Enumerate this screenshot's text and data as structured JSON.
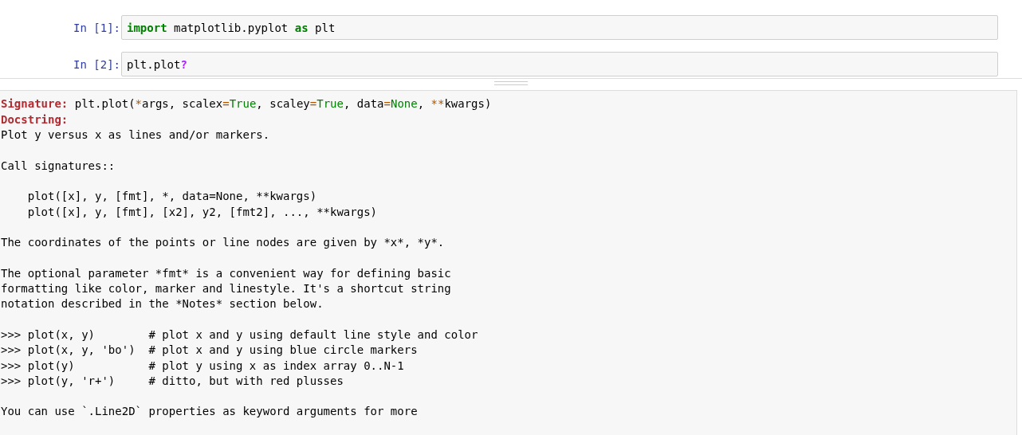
{
  "cells": [
    {
      "prompt": "In [1]:",
      "tokens": [
        {
          "text": "import",
          "kind": "keyword"
        },
        {
          "text": " matplotlib.pyplot ",
          "kind": "plain"
        },
        {
          "text": "as",
          "kind": "keyword"
        },
        {
          "text": " plt",
          "kind": "plain"
        }
      ]
    },
    {
      "prompt": "In [2]:",
      "tokens": [
        {
          "text": "plt.plot",
          "kind": "plain"
        },
        {
          "text": "?",
          "kind": "help"
        }
      ]
    }
  ],
  "pager": {
    "signature": [
      {
        "text": "Signature:",
        "kind": "label"
      },
      {
        "text": " plt.plot(",
        "kind": "plain"
      },
      {
        "text": "*",
        "kind": "op"
      },
      {
        "text": "args, scalex",
        "kind": "plain"
      },
      {
        "text": "=",
        "kind": "op"
      },
      {
        "text": "True",
        "kind": "constant"
      },
      {
        "text": ", scaley",
        "kind": "plain"
      },
      {
        "text": "=",
        "kind": "op"
      },
      {
        "text": "True",
        "kind": "constant"
      },
      {
        "text": ", data",
        "kind": "plain"
      },
      {
        "text": "=",
        "kind": "op"
      },
      {
        "text": "None",
        "kind": "constant"
      },
      {
        "text": ", ",
        "kind": "plain"
      },
      {
        "text": "**",
        "kind": "op"
      },
      {
        "text": "kwargs)",
        "kind": "plain"
      }
    ],
    "docstring_label": "Docstring:",
    "paragraphs": [
      [
        "Plot y versus x as lines and/or markers."
      ],
      [
        "Call signatures::"
      ],
      [
        "    plot([x], y, [fmt], *, data=None, **kwargs)",
        "    plot([x], y, [fmt], [x2], y2, [fmt2], ..., **kwargs)"
      ],
      [
        "The coordinates of the points or line nodes are given by *x*, *y*."
      ],
      [
        "The optional parameter *fmt* is a convenient way for defining basic",
        "formatting like color, marker and linestyle. It's a shortcut string",
        "notation described in the *Notes* section below."
      ],
      [
        ">>> plot(x, y)        # plot x and y using default line style and color",
        ">>> plot(x, y, 'bo')  # plot x and y using blue circle markers",
        ">>> plot(y)           # plot y using x as index array 0..N-1",
        ">>> plot(y, 'r+')     # ditto, but with red plusses"
      ],
      [
        "You can use `.Line2D` properties as keyword arguments for more"
      ]
    ]
  }
}
